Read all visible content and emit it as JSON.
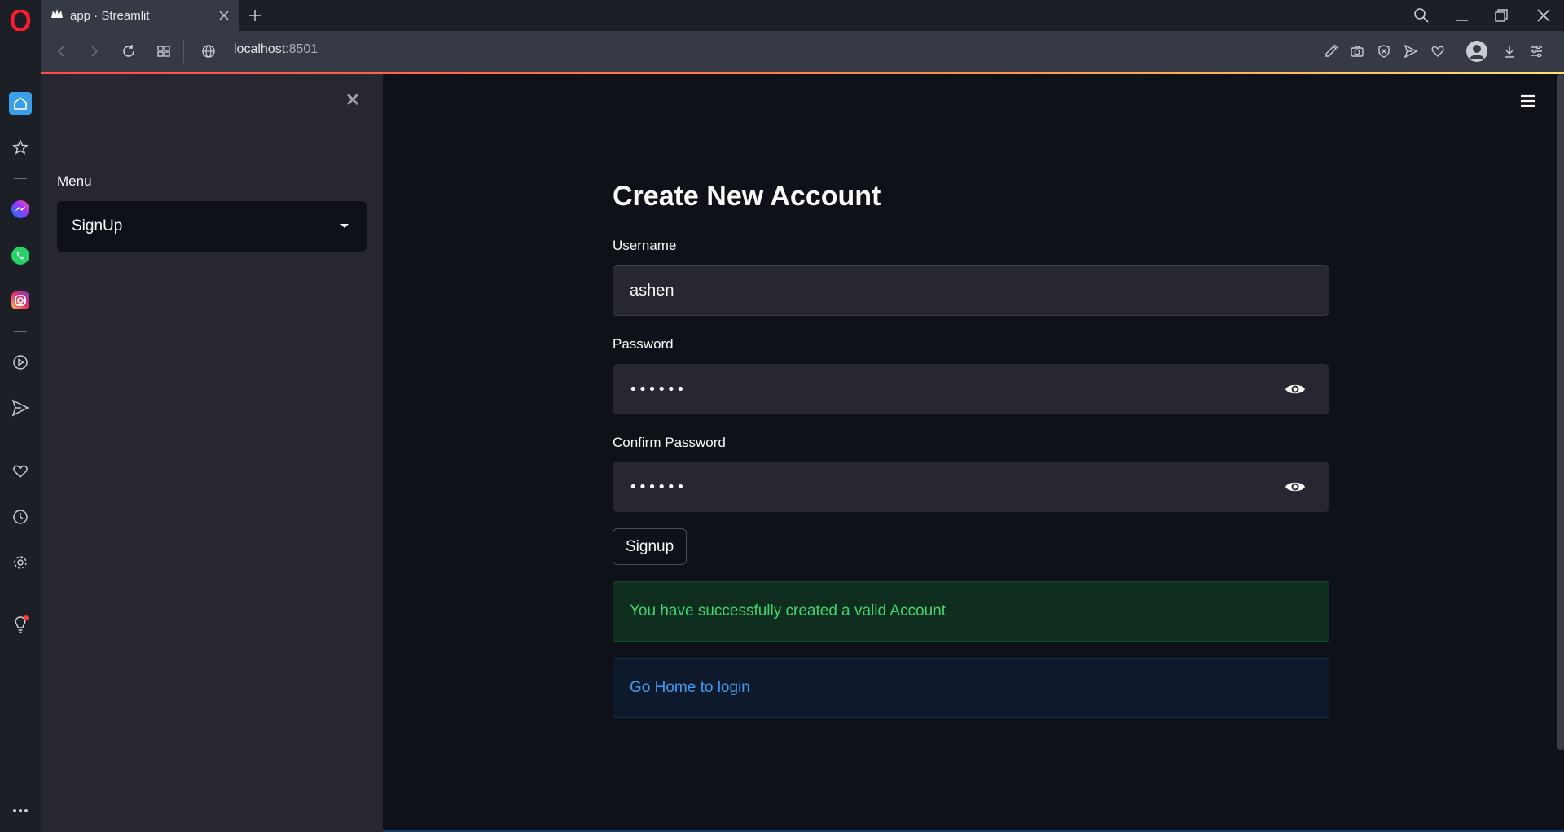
{
  "browser": {
    "tab_title": "app · Streamlit",
    "url_host": "localhost",
    "url_port": ":8501",
    "accent_gradient": [
      "#ff4b4b",
      "#ffe36b"
    ]
  },
  "opera_sidebar": {
    "items": [
      "home-icon",
      "star-icon",
      "messenger-icon",
      "whatsapp-icon",
      "instagram-icon",
      "player-icon",
      "send-icon",
      "heart-icon",
      "history-icon",
      "settings-icon",
      "lightbulb-icon",
      "more-icon"
    ]
  },
  "sidebar": {
    "menu_label": "Menu",
    "selected": "SignUp"
  },
  "form": {
    "title": "Create New Account",
    "username_label": "Username",
    "username_value": "ashen",
    "password_label": "Password",
    "password_mask": "••••••",
    "confirm_label": "Confirm Password",
    "confirm_mask": "••••••",
    "submit_label": "Signup"
  },
  "messages": {
    "success": "You have successfully created a valid Account",
    "info": "Go Home to login"
  },
  "colors": {
    "background": "#0e1117",
    "sidebar": "#262730",
    "success_text": "#3dd56d",
    "info_text": "#3d9df3"
  }
}
